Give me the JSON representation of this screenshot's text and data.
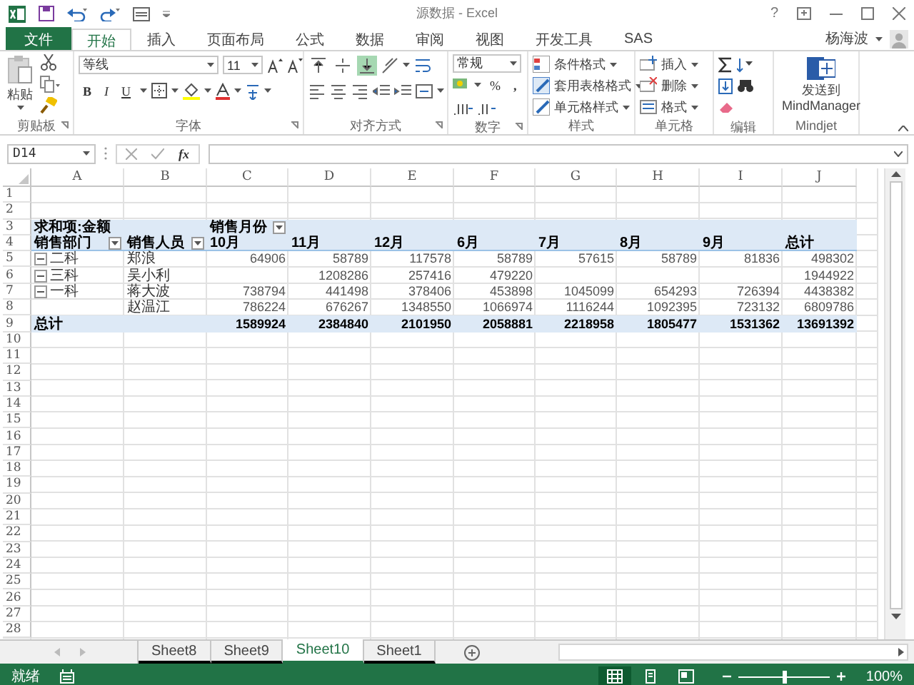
{
  "window": {
    "title": "源数据 - Excel",
    "help": "?"
  },
  "ribbon_tabs": [
    {
      "label": "文件",
      "kind": "file",
      "selected": false
    },
    {
      "label": "开始",
      "kind": "tab",
      "selected": true
    },
    {
      "label": "插入",
      "kind": "tab",
      "selected": false
    },
    {
      "label": "页面布局",
      "kind": "tab",
      "selected": false
    },
    {
      "label": "公式",
      "kind": "tab",
      "selected": false
    },
    {
      "label": "数据",
      "kind": "tab",
      "selected": false
    },
    {
      "label": "审阅",
      "kind": "tab",
      "selected": false
    },
    {
      "label": "视图",
      "kind": "tab",
      "selected": false
    },
    {
      "label": "开发工具",
      "kind": "tab",
      "selected": false
    },
    {
      "label": "SAS",
      "kind": "tab",
      "selected": false
    }
  ],
  "user": {
    "name": "杨海波"
  },
  "ribbon": {
    "clipboard": {
      "label": "剪贴板",
      "paste": "粘贴"
    },
    "font": {
      "label": "字体",
      "font_name": "等线",
      "font_size": "11",
      "bold": "B",
      "italic": "I",
      "underline": "U"
    },
    "alignment": {
      "label": "对齐方式",
      "vertical": [
        {
          "kind": "top",
          "selected": false
        },
        {
          "kind": "middle",
          "selected": false
        },
        {
          "kind": "bottom",
          "selected": true
        }
      ]
    },
    "number": {
      "label": "数字",
      "format": "常规",
      "percent": "%",
      "comma": ","
    },
    "styles": {
      "label": "样式",
      "items": [
        "条件格式",
        "套用表格格式",
        "单元格样式"
      ]
    },
    "cells": {
      "label": "单元格",
      "items": [
        "插入",
        "删除",
        "格式"
      ]
    },
    "editing": {
      "label": "编辑"
    },
    "mindjet": {
      "label": "Mindjet",
      "button": "发送到 MindManager"
    }
  },
  "formula_bar": {
    "name_box": "D14",
    "function_label": "fx"
  },
  "sheet": {
    "columns": [
      "A",
      "B",
      "C",
      "D",
      "E",
      "F",
      "G",
      "H",
      "I",
      "J"
    ],
    "rows": [
      {
        "number": "1",
        "kind": "blank"
      },
      {
        "number": "2",
        "kind": "blank"
      },
      {
        "number": "3",
        "kind": "header",
        "cells": {
          "A": {
            "text": "求和项:金额"
          },
          "C": {
            "text": "销售月份",
            "filter": true
          }
        }
      },
      {
        "number": "4",
        "kind": "header",
        "cells": {
          "A": {
            "text": "销售部门",
            "filter": true
          },
          "B": {
            "text": "销售人员",
            "filter": true
          },
          "C": {
            "text": "10月"
          },
          "D": {
            "text": "11月"
          },
          "E": {
            "text": "12月"
          },
          "F": {
            "text": "6月"
          },
          "G": {
            "text": "7月"
          },
          "H": {
            "text": "8月"
          },
          "I": {
            "text": "9月"
          },
          "J": {
            "text": "总计"
          }
        }
      },
      {
        "number": "5",
        "kind": "item",
        "cells": {
          "A": {
            "text": "二科",
            "expanded": true
          },
          "B": {
            "text": "郑浪"
          },
          "C": {
            "text": "64906"
          },
          "D": {
            "text": "58789"
          },
          "E": {
            "text": "117578"
          },
          "F": {
            "text": "58789"
          },
          "G": {
            "text": "57615"
          },
          "H": {
            "text": "58789"
          },
          "I": {
            "text": "81836"
          },
          "J": {
            "text": "498302"
          }
        }
      },
      {
        "number": "6",
        "kind": "item",
        "cells": {
          "A": {
            "text": "三科",
            "expanded": true
          },
          "B": {
            "text": "吴小利"
          },
          "D": {
            "text": "1208286"
          },
          "E": {
            "text": "257416"
          },
          "F": {
            "text": "479220"
          },
          "J": {
            "text": "1944922"
          }
        }
      },
      {
        "number": "7",
        "kind": "item",
        "cells": {
          "A": {
            "text": "一科",
            "expanded": true
          },
          "B": {
            "text": "蒋大波"
          },
          "C": {
            "text": "738794"
          },
          "D": {
            "text": "441498"
          },
          "E": {
            "text": "378406"
          },
          "F": {
            "text": "453898"
          },
          "G": {
            "text": "1045099"
          },
          "H": {
            "text": "654293"
          },
          "I": {
            "text": "726394"
          },
          "J": {
            "text": "4438382"
          }
        }
      },
      {
        "number": "8",
        "kind": "item",
        "cells": {
          "B": {
            "text": "赵温江"
          },
          "C": {
            "text": "786224"
          },
          "D": {
            "text": "676267"
          },
          "E": {
            "text": "1348550"
          },
          "F": {
            "text": "1066974"
          },
          "G": {
            "text": "1116244"
          },
          "H": {
            "text": "1092395"
          },
          "I": {
            "text": "723132"
          },
          "J": {
            "text": "6809786"
          }
        }
      },
      {
        "number": "9",
        "kind": "total",
        "cells": {
          "A": {
            "text": "总计"
          },
          "C": {
            "text": "1589924"
          },
          "D": {
            "text": "2384840"
          },
          "E": {
            "text": "2101950"
          },
          "F": {
            "text": "2058881"
          },
          "G": {
            "text": "2218958"
          },
          "H": {
            "text": "1805477"
          },
          "I": {
            "text": "1531362"
          },
          "J": {
            "text": "13691392"
          }
        }
      },
      {
        "number": "10",
        "kind": "blank"
      },
      {
        "number": "11",
        "kind": "blank"
      },
      {
        "number": "12",
        "kind": "blank"
      },
      {
        "number": "13",
        "kind": "blank"
      },
      {
        "number": "14",
        "kind": "blank"
      },
      {
        "number": "15",
        "kind": "blank"
      },
      {
        "number": "16",
        "kind": "blank"
      },
      {
        "number": "17",
        "kind": "blank"
      },
      {
        "number": "18",
        "kind": "blank"
      },
      {
        "number": "19",
        "kind": "blank"
      },
      {
        "number": "20",
        "kind": "blank"
      },
      {
        "number": "21",
        "kind": "blank"
      },
      {
        "number": "22",
        "kind": "blank"
      },
      {
        "number": "23",
        "kind": "blank"
      },
      {
        "number": "24",
        "kind": "blank"
      },
      {
        "number": "25",
        "kind": "blank"
      },
      {
        "number": "26",
        "kind": "blank"
      },
      {
        "number": "27",
        "kind": "blank"
      },
      {
        "number": "28",
        "kind": "blank"
      }
    ]
  },
  "sheet_tabs": [
    {
      "label": "Sheet8",
      "selected": false
    },
    {
      "label": "Sheet9",
      "selected": false
    },
    {
      "label": "Sheet10",
      "selected": true
    },
    {
      "label": "Sheet1",
      "selected": false
    }
  ],
  "status_bar": {
    "status": "就绪",
    "views": [
      {
        "kind": "normal",
        "selected": true
      },
      {
        "kind": "page_layout",
        "selected": false
      },
      {
        "kind": "page_break",
        "selected": false
      }
    ],
    "zoom": {
      "level": 0.5,
      "reading": "100%"
    }
  }
}
